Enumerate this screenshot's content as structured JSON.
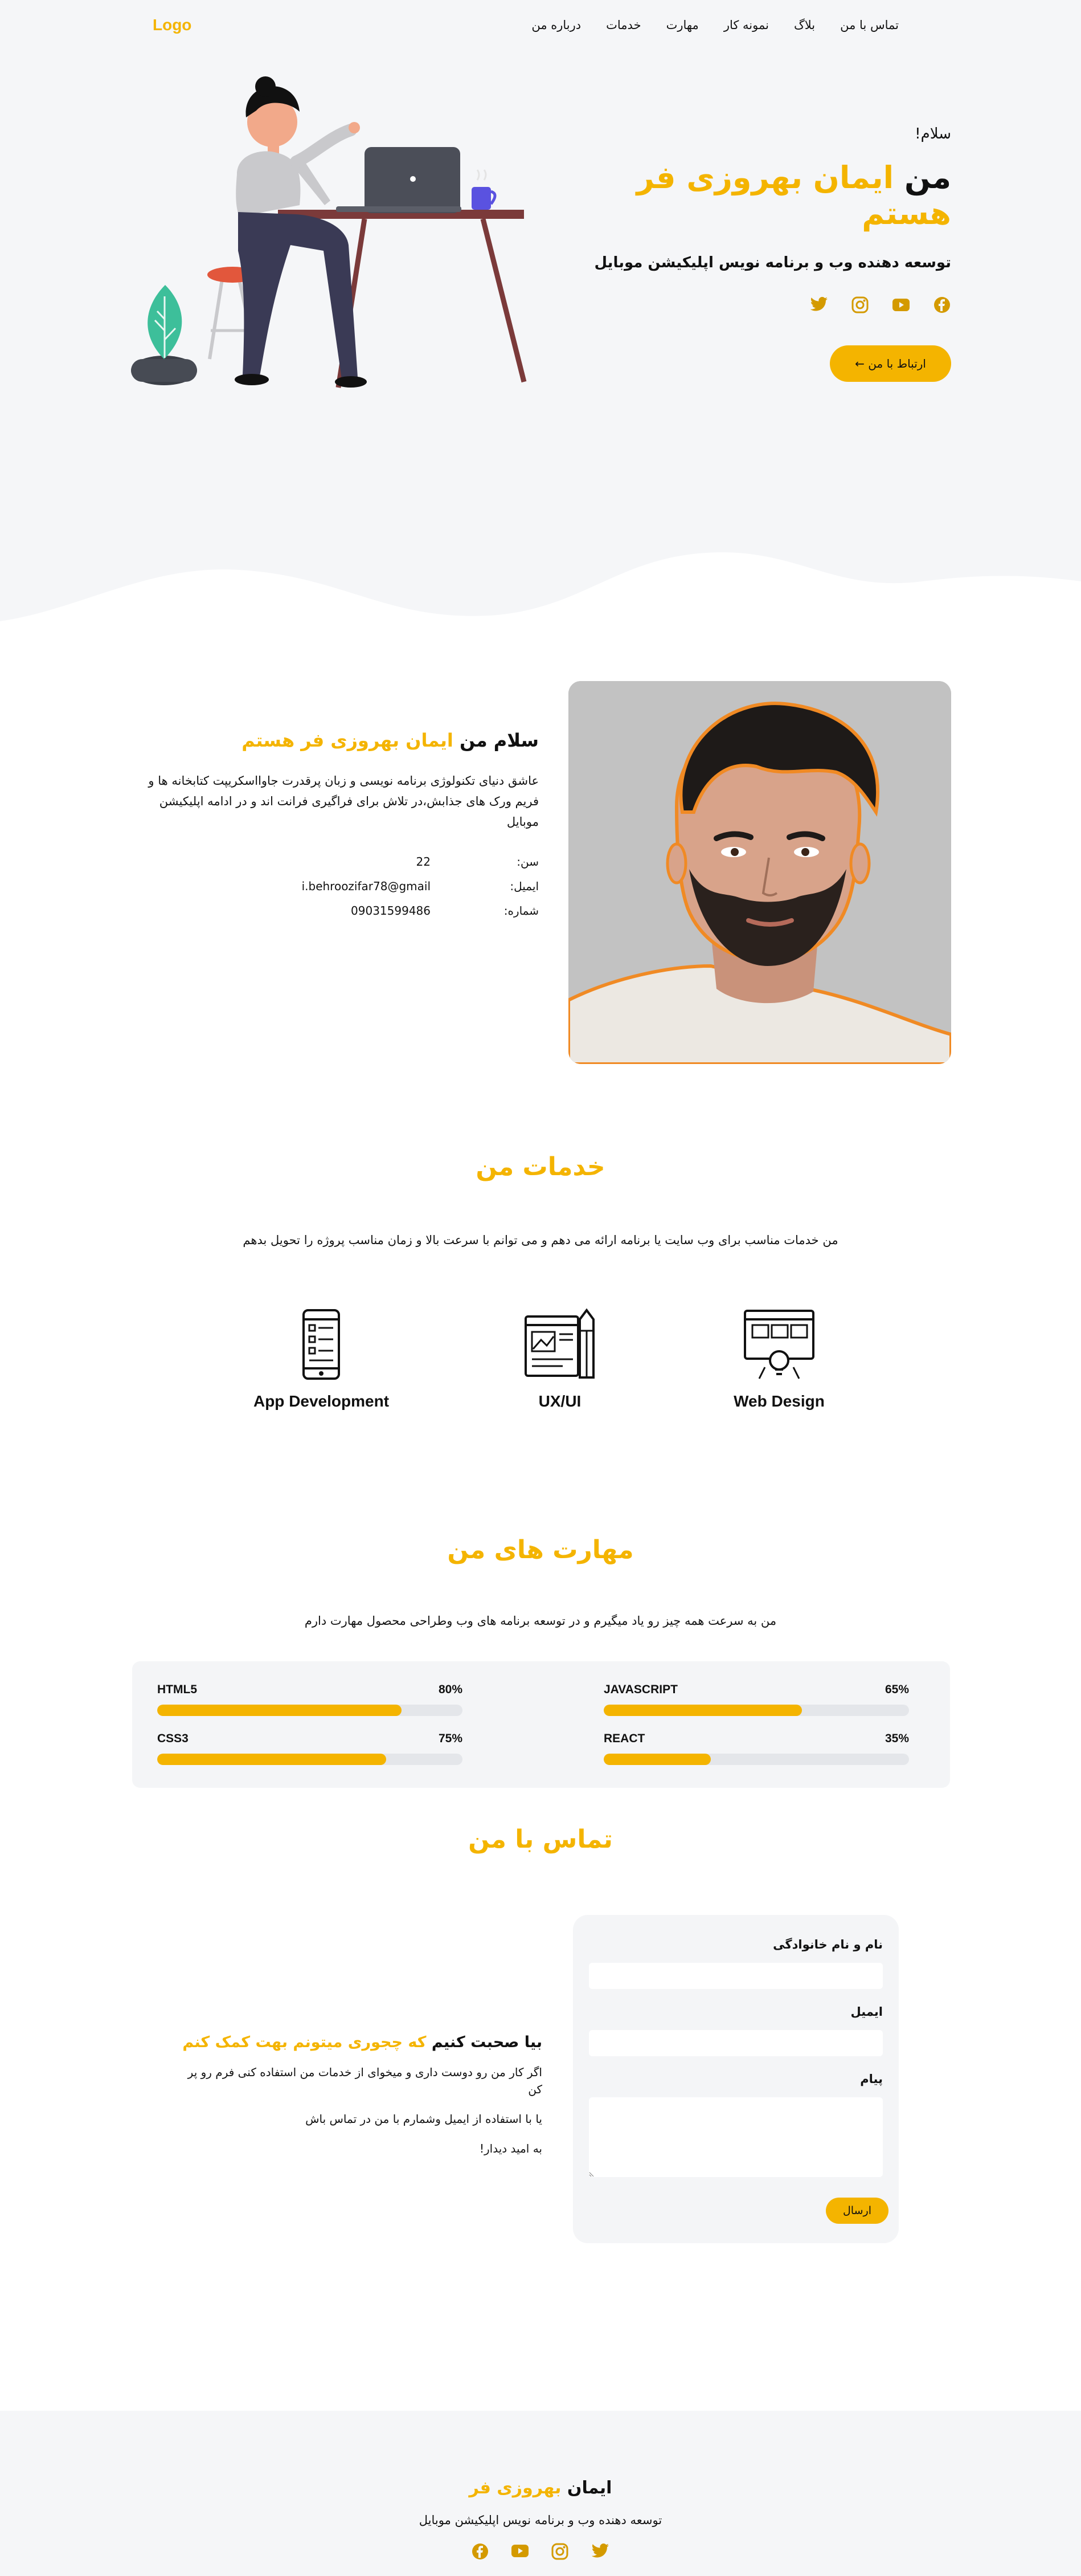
{
  "nav": {
    "logo": "Logo",
    "links": [
      "درباره من",
      "خدمات",
      "مهارت",
      "نمونه کار",
      "بلاگ",
      "تماس با من"
    ]
  },
  "hero": {
    "hello": "سلام!",
    "title_prefix": "من ",
    "title_name": "ایمان بهروزی فر هستم",
    "subtitle": "توسعه دهنده وب و برنامه نویس اپلیکیشن موبایل",
    "socials": [
      "facebook-icon",
      "youtube-icon",
      "instagram-icon",
      "twitter-icon"
    ],
    "cta": "ارتباط با من ←"
  },
  "about": {
    "title_prefix": "سلام من ",
    "title_name": "ایمان بهروزی فر هستم",
    "description": "عاشق دنیای تکنولوژی برنامه نویسی و زبان پرقدرت جاوااسکریپت کتابخانه ها و فریم ورک های جذابش،در تلاش برای فراگیری فرانت اند و در ادامه اپلیکیشن موبایل",
    "info": [
      {
        "label": "سن:",
        "value": "22"
      },
      {
        "label": "ایمیل:",
        "value": "i.behroozifar78@gmail"
      },
      {
        "label": "شماره:",
        "value": "09031599486"
      }
    ]
  },
  "services": {
    "title": "خدمات من",
    "description": "من خدمات مناسب برای وب سایت یا برنامه ارائه می دهم و می توانم با سرعت بالا و زمان مناسب پروژه را تحویل بدهم",
    "items": [
      {
        "name": "Web Design",
        "icon": "web-design-icon"
      },
      {
        "name": "UX/UI",
        "icon": "ux-ui-icon"
      },
      {
        "name": "App Development",
        "icon": "mobile-app-icon"
      }
    ]
  },
  "skills": {
    "title": "مهارت های من",
    "description": "من به سرعت همه چیز رو یاد میگیرم و در توسعه برنامه های وب وطراحی محصول مهارت دارم",
    "items": [
      {
        "name": "HTML5",
        "percent_label": "80%",
        "level": 0.8
      },
      {
        "name": "JAVASCRIPT",
        "percent_label": "65%",
        "level": 0.65
      },
      {
        "name": "CSS3",
        "percent_label": "75%",
        "level": 0.75
      },
      {
        "name": "REACT",
        "percent_label": "35%",
        "level": 0.35
      }
    ]
  },
  "contact": {
    "title": "تماس با من",
    "form": {
      "name_label": "نام و نام خانوادگی",
      "email_label": "ایمیل",
      "message_label": "پیام",
      "send_label": "ارسال"
    },
    "side_title_prefix": "بیا صحبت کنیم ",
    "side_title_highlight": "که چجوری میتونم بهت کمک کنم",
    "lines": [
      "اگر کار من رو دوست داری و میخوای از خدمات من استفاده کنی فرم رو پر کن",
      "یا با استفاده از ایمیل وشمارم با من در تماس باش",
      "به امید دیدار!"
    ]
  },
  "footer": {
    "title_prefix": "ایمان ",
    "title_highlight": "بهروزی فر",
    "subtitle": "توسعه دهنده وب و برنامه نویس اپلیکیشن موبایل",
    "socials": [
      "facebook-icon",
      "youtube-icon",
      "instagram-icon",
      "twitter-icon"
    ]
  },
  "colors": {
    "accent": "#f4b400",
    "section_bg": "#f5f6f8",
    "photo_outline": "#f08a24"
  }
}
